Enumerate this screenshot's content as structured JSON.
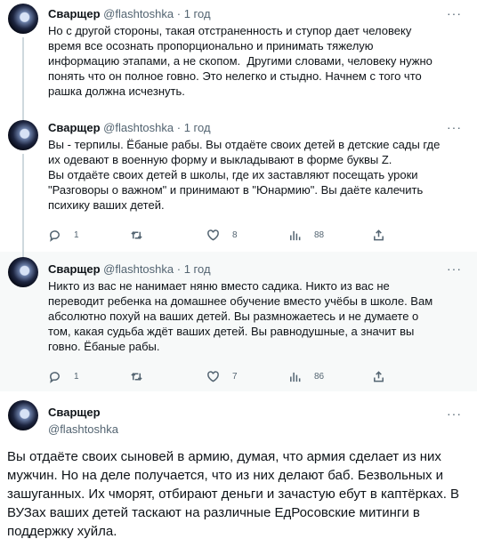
{
  "tweets": [
    {
      "name": "Сварщер",
      "handle": "@flashtoshka",
      "dot": "·",
      "time": "1 год",
      "text": "Но с другой стороны, такая отстраненность и ступор дает человеку\nвремя все осознать пропорционально и принимать тяжелую\nинформацию этапами, а не скопом.  Другими словами, человеку нужно\nпонять что он полное говно. Это нелегко и стыдно. Начнем с того что\nрашка должна исчезнуть."
    },
    {
      "name": "Сварщер",
      "handle": "@flashtoshka",
      "dot": "·",
      "time": "1 год",
      "text": "Вы - терпилы. Ёбаные рабы. Вы отдаёте своих детей в детские сады где\nих одевают в военную форму и выкладывают в форме буквы Z.\nВы отдаёте своих детей в школы, где их заставляют посещать уроки\n\"Разговоры о важном\" и принимают в \"Юнармию\". Вы даёте калечить\nпсихику ваших детей.",
      "actions": {
        "replies": "1",
        "retweets": "",
        "likes": "8",
        "views": "88"
      }
    },
    {
      "name": "Сварщер",
      "handle": "@flashtoshka",
      "dot": "·",
      "time": "1 год",
      "text": "Никто из вас не нанимает няню вместо садика. Никто из вас не\nпереводит ребенка на домашнее обучение вместо учёбы в школе. Вам\nабсолютно похуй на ваших детей. Вы размножаетесь и не думаете о\nтом, какая судьба ждёт ваших детей. Вы равнодушные, а значит вы\nговно. Ёбаные рабы.",
      "actions": {
        "replies": "1",
        "retweets": "",
        "likes": "7",
        "views": "86"
      }
    }
  ],
  "main_tweet": {
    "name": "Сварщер",
    "handle": "@flashtoshka",
    "text": "Вы отдаёте своих сыновей в армию, думая, что армия сделает из них\nмужчин. Но на деле получается, что из них делают баб. Безвольных и\nзашуганных. Их чморят, отбирают деньги и зачастую ебут в каптёрках. В\nВУЗах ваших детей таскают на различные ЕдРосовские митинги в\nподдержку хуйла."
  },
  "icons": {
    "reply": "reply-icon",
    "retweet": "retweet-icon",
    "like": "heart-icon",
    "views": "views-icon",
    "share": "share-icon",
    "more": "more-icon"
  },
  "colors": {
    "text": "#0f1419",
    "secondary": "#536471",
    "thread_line": "#cfd9de",
    "hover_bg": "#f7f9f9"
  }
}
